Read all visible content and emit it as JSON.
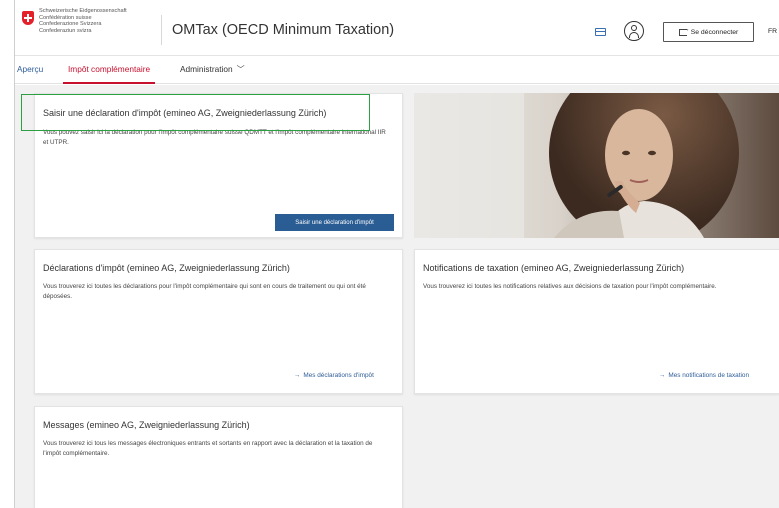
{
  "header": {
    "confederation_lines": [
      "Schweizerische Eidgenossenschaft",
      "Confédération suisse",
      "Confederazione Svizzera",
      "Confederaziun svizra"
    ],
    "app_title": "OMTax (OECD Minimum Taxation)",
    "logout_label": "Se déconnecter",
    "language": "FR"
  },
  "nav": {
    "tabs": [
      {
        "label": "Aperçu"
      },
      {
        "label": "Impôt complémentaire"
      },
      {
        "label": "Administration"
      }
    ]
  },
  "cards": {
    "submit": {
      "title": "Saisir une déclaration d'impôt (emineo AG, Zweigniederlassung Zürich)",
      "description": "Vous pouvez saisir ici la déclaration pour l'impôt complémentaire suisse QDMTT et l'impôt complémentaire international IIR et UTPR.",
      "button_label": "Saisir une déclaration d'impôt"
    },
    "declarations": {
      "title": "Déclarations d'impôt (emineo AG, Zweigniederlassung Zürich)",
      "description": "Vous trouverez ici toutes les déclarations pour l'impôt complémentaire qui sont en cours de traitement ou qui ont été déposées.",
      "link_label": "Mes déclarations d'impôt"
    },
    "notifications": {
      "title": "Notifications de taxation (emineo AG, Zweigniederlassung Zürich)",
      "description": "Vous trouverez ici toutes les notifications relatives aux décisions de taxation pour l'impôt complémentaire.",
      "link_label": "Mes notifications de taxation"
    },
    "messages": {
      "title": "Messages (emineo AG, Zweigniederlassung Zürich)",
      "description": "Vous trouverez ici tous les messages électroniques entrants et sortants en rapport avec la déclaration et la taxation de l'impôt complémentaire."
    }
  },
  "colors": {
    "brand_red": "#c8102e",
    "primary_blue": "#2a5d94",
    "link_blue": "#2f5d99",
    "highlight_green": "#2ea043"
  }
}
